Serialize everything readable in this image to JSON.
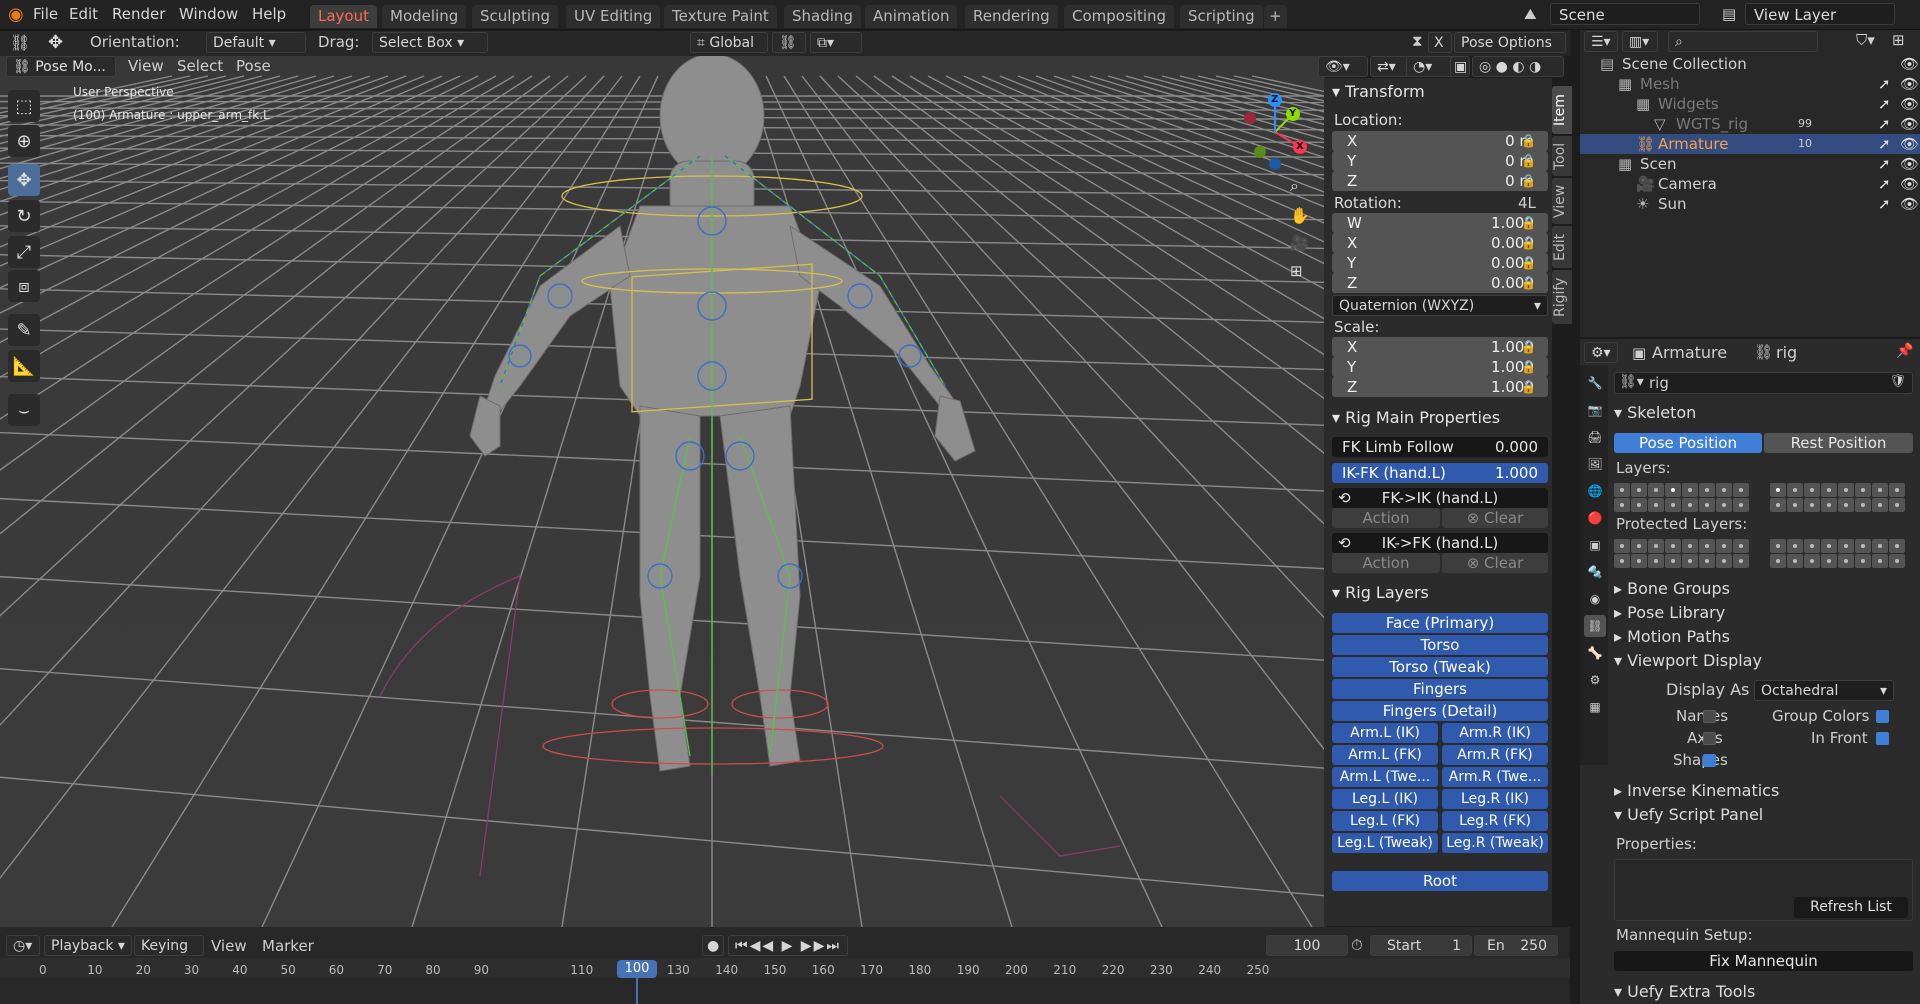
{
  "menubar": {
    "menus": [
      "File",
      "Edit",
      "Render",
      "Window",
      "Help"
    ],
    "workspaces": [
      "Layout",
      "Modeling",
      "Sculpting",
      "UV Editing",
      "Texture Paint",
      "Shading",
      "Animation",
      "Rendering",
      "Compositing",
      "Scripting"
    ],
    "add_tab": "+",
    "scene": "Scene",
    "view_layer": "View Layer"
  },
  "tool_header": {
    "orientation_label": "Orientation:",
    "orientation_value": "Default",
    "drag_label": "Drag:",
    "drag_value": "Select Box",
    "transform_orientation": "Global",
    "mirror_x": "X",
    "pose_options": "Pose Options"
  },
  "viewport_header": {
    "mode": "Pose Mo...",
    "menus": [
      "View",
      "Select",
      "Pose"
    ]
  },
  "viewport": {
    "perspective": "User Perspective",
    "active_object": "(100) Armature : upper_arm_fk.L",
    "gizmo": {
      "x": "X",
      "y": "Y",
      "z": "Z"
    }
  },
  "npanel": {
    "tabs": [
      "Item",
      "Tool",
      "View",
      "Edit",
      "Rigify"
    ],
    "transform": {
      "title": "Transform",
      "location_label": "Location:",
      "location": [
        {
          "axis": "X",
          "value": "0 m"
        },
        {
          "axis": "Y",
          "value": "0 m"
        },
        {
          "axis": "Z",
          "value": "0 m"
        }
      ],
      "rotation_label": "Rotation:",
      "rotation_mode_short": "4L",
      "rotation": [
        {
          "axis": "W",
          "value": "1.000"
        },
        {
          "axis": "X",
          "value": "0.000"
        },
        {
          "axis": "Y",
          "value": "0.000"
        },
        {
          "axis": "Z",
          "value": "0.000"
        }
      ],
      "rotation_mode": "Quaternion (WXYZ)",
      "scale_label": "Scale:",
      "scale": [
        {
          "axis": "X",
          "value": "1.000"
        },
        {
          "axis": "Y",
          "value": "1.000"
        },
        {
          "axis": "Z",
          "value": "1.000"
        }
      ]
    },
    "rig_main": {
      "title": "Rig Main Properties",
      "fk_limb_follow_label": "FK Limb Follow",
      "fk_limb_follow_value": "0.000",
      "ik_fk_label": "IK-FK (hand.L)",
      "ik_fk_value": "1.000",
      "fk_ik_button": "FK->IK (hand.L)",
      "ik_fk_button": "IK->FK (hand.L)",
      "action": "Action",
      "clear": "Clear"
    },
    "rig_layers": {
      "title": "Rig Layers",
      "full": [
        "Face (Primary)",
        "Torso",
        "Torso (Tweak)",
        "Fingers",
        "Fingers (Detail)"
      ],
      "pairs": [
        [
          "Arm.L (IK)",
          "Arm.R (IK)"
        ],
        [
          "Arm.L (FK)",
          "Arm.R (FK)"
        ],
        [
          "Arm.L (Twe...",
          "Arm.R (Twe..."
        ],
        [
          "Leg.L (IK)",
          "Leg.R (IK)"
        ],
        [
          "Leg.L (FK)",
          "Leg.R (FK)"
        ],
        [
          "Leg.L (Tweak)",
          "Leg.R (Tweak)"
        ]
      ],
      "root": "Root"
    }
  },
  "outliner": {
    "search_placeholder": "",
    "items": [
      {
        "label": "Scene Collection",
        "indent": 0
      },
      {
        "label": "Mesh",
        "indent": 1,
        "dim": true
      },
      {
        "label": "Widgets",
        "indent": 2,
        "dim": true
      },
      {
        "label": "WGTS_rig",
        "indent": 3,
        "dim": true,
        "badge": "99"
      },
      {
        "label": "Armature",
        "indent": 2,
        "selected": true,
        "badge": "10"
      },
      {
        "label": "Scen",
        "indent": 1
      },
      {
        "label": "Camera",
        "indent": 2
      },
      {
        "label": "Sun",
        "indent": 2
      }
    ]
  },
  "properties": {
    "object": "Armature",
    "data": "rig",
    "data_field": "rig",
    "skeleton": {
      "title": "Skeleton",
      "pose_position": "Pose Position",
      "rest_position": "Rest Position",
      "layers_label": "Layers:",
      "protected_label": "Protected Layers:"
    },
    "collapsed_sections": [
      "Bone Groups",
      "Pose Library",
      "Motion Paths"
    ],
    "viewport_display": {
      "title": "Viewport Display",
      "display_as_label": "Display As",
      "display_as_value": "Octahedral",
      "names": "Names",
      "names_on": false,
      "axes": "Axes",
      "axes_on": false,
      "shapes": "Shapes",
      "shapes_on": true,
      "group_colors": "Group Colors",
      "group_colors_on": true,
      "in_front": "In Front",
      "in_front_on": true
    },
    "inverse_kinematics": "Inverse Kinematics",
    "uefy_script": {
      "title": "Uefy Script Panel",
      "properties_label": "Properties:",
      "refresh": "Refresh List",
      "mannequin_label": "Mannequin Setup:",
      "fix": "Fix Mannequin"
    },
    "uefy_extra": "Uefy Extra Tools"
  },
  "timeline": {
    "menus": [
      "Playback",
      "Keying",
      "View",
      "Marker"
    ],
    "current_frame": "100",
    "start_label": "Start",
    "start": "1",
    "end_label": "En",
    "end": "250",
    "ticks": [
      "0",
      "10",
      "20",
      "30",
      "40",
      "50",
      "60",
      "70",
      "80",
      "90",
      "100",
      "110",
      "120",
      "130",
      "140",
      "150",
      "160",
      "170",
      "180",
      "190",
      "200",
      "210",
      "220",
      "230",
      "240",
      "250"
    ],
    "playhead": "100"
  },
  "colors": {
    "accent": "#ff6b52",
    "selection_blue": "#2f5aae",
    "active_blue": "#4b6e9a",
    "viewport_bg": "#383838",
    "grid": "#8a8a8a"
  }
}
